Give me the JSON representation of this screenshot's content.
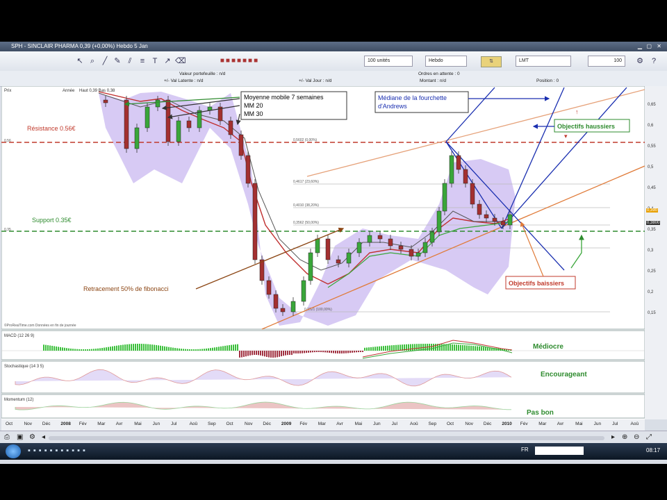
{
  "window": {
    "title": "SPH - SINCLAIR PHARMA   0,39 (+0,00%)   Hebdo  5 Jan"
  },
  "toolbar": {
    "quantity": "100 unités",
    "period": "Hebdo",
    "order_type": "LMT",
    "qty_value": "100"
  },
  "infobar": {
    "valeur_portefeuille": "Valeur portefeuille : n/d",
    "val_latente": "+/- Val Latente : n/d",
    "val_jour": "+/- Val Jour : n/d",
    "ordres": "Ordres en attente : 0",
    "montant": "Montant : n/d",
    "position": "Position : 0"
  },
  "panels": {
    "price_tag": "Prix",
    "price_period": "Année",
    "price_header": "Haut 0,39  Bas 0,38",
    "copyright": "©ProRealTime.com  Données en fin de journée",
    "macd_tag": "MACD (12 26 9)",
    "stoch_tag": "Stochastique (14 3 5)",
    "momentum_tag": "Momentum (12)"
  },
  "annotations": {
    "resistance": "Résistance 0.56€",
    "support": "Support 0.35€",
    "retracement": "Retracement 50% de fibonacci",
    "mm_line1": "Moyenne mobile 7 semaines",
    "mm_line2": "MM 20",
    "mm_line3": "MM 30",
    "andrews_line1": "Médiane de la fourchette",
    "andrews_line2": "d'Andrews",
    "obj_haussiers": "Objectifs haussiers",
    "obj_baissiers": "Objectifs baissiers",
    "macd_comment": "Médiocre",
    "stoch_comment": "Encourageant",
    "momentum_comment": "Pas bon"
  },
  "fib_levels": [
    "0,5602 (0,00%)",
    "0,4617 (23,60%)",
    "0,4010 (38,20%)",
    "0,3562 (50,00%)",
    "0,1521 (100,00%)"
  ],
  "left_levels": {
    "r": "0,56",
    "s": "0,35"
  },
  "right_axis": [
    "0,65",
    "0,6",
    "0,55",
    "0,5",
    "0,45",
    "0,4",
    "0,35",
    "0,3",
    "0,25",
    "0,2",
    "0,15"
  ],
  "price_badges": {
    "last": "0,390",
    "prev": "0,3800"
  },
  "time_axis": [
    "Oct",
    "Nov",
    "Déc",
    "2008",
    "Fév",
    "Mar",
    "Avr",
    "Mai",
    "Jun",
    "Jul",
    "Aoû",
    "Sep",
    "Oct",
    "Nov",
    "Déc",
    "2009",
    "Fév",
    "Mar",
    "Avr",
    "Mai",
    "Jun",
    "Jul",
    "Aoû",
    "Sep",
    "Oct",
    "Nov",
    "Déc",
    "2010",
    "Fév",
    "Mar",
    "Avr",
    "Mai",
    "Jun",
    "Jul",
    "Aoû"
  ],
  "taskbar": {
    "lang": "FR",
    "clock": "08:17"
  },
  "colors": {
    "resistance": "#c0392b",
    "support": "#2e8b2e",
    "andrews": "#1a2fb0",
    "retracement": "#8b4513",
    "bollinger": "#c9b8f0"
  }
}
